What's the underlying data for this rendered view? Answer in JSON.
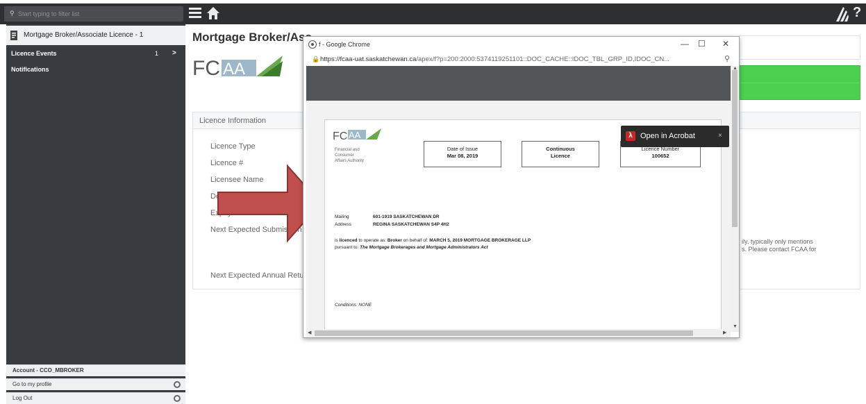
{
  "search": {
    "placeholder": "Start typing to filter list"
  },
  "sidebar": {
    "header_title": "Mortgage Broker/Associate Licence - 1",
    "items": [
      {
        "label": "Licence Events",
        "count": "1",
        "chevron": ">"
      },
      {
        "label": "Notifications"
      }
    ],
    "footer": [
      {
        "label": "Account - CCO_MBROKER"
      },
      {
        "label": "Go to my profile"
      },
      {
        "label": "Log Out"
      }
    ]
  },
  "main": {
    "page_title": "Mortgage Broker/Ass",
    "panel_title": "Licence Information",
    "fields": [
      "Licence Type",
      "Licence #",
      "Licensee Name",
      "De",
      "Expiry Date",
      "Next Expected Submission",
      "Next Expected Annual Retur"
    ],
    "note_lines": [
      "ily, typically only mentions",
      "s. Please contact FCAA for"
    ]
  },
  "popup": {
    "window_title": "f - Google Chrome",
    "url_host": "https://fcaa-uat.saskatchewan.ca",
    "url_path": "/apex/f?p=200:2000:5374119251101::DOC_CACHE::IDOC_TBL_GRP_ID,IDOC_CN...",
    "minimize": "—",
    "maximize": "☐",
    "close": "✕"
  },
  "licence": {
    "logo_sub": [
      "Financial and",
      "Consumer",
      "Affairs Authority"
    ],
    "date_of_issue_label": "Date of Issue",
    "date_of_issue": "Mar 08, 2019",
    "continuous_1": "Continuous",
    "continuous_2": "Licence",
    "licence_number_label": "Licence Number",
    "licence_number": "100652",
    "mailing_label": "Mailing",
    "address_label": "Address",
    "address_1": "601-1919 SASKATCHEWAN DR",
    "address_2": "REGINA SASKATCHEWAN S4P 4H2",
    "licenced_prefix": "is",
    "licenced_word": "licenced",
    "licenced_mid": "to operate as:",
    "role": "Broker",
    "behalf_text": "on behalf of:",
    "company": "MARCH 5, 2019 MORTGAGE BROKERAGE LLP",
    "pursuant": "pursuant to:",
    "act": "The Mortgage Brokerages and Mortgage Administrators Act",
    "conditions": "Conditions: NONE"
  },
  "toast": {
    "label": "Open in Acrobat",
    "close": "×"
  },
  "colors": {
    "accent_green": "#4bd04f",
    "arrow_red": "#c0504d",
    "dark_bar": "#2e2f31",
    "sidebar_bg": "#383b3f"
  }
}
